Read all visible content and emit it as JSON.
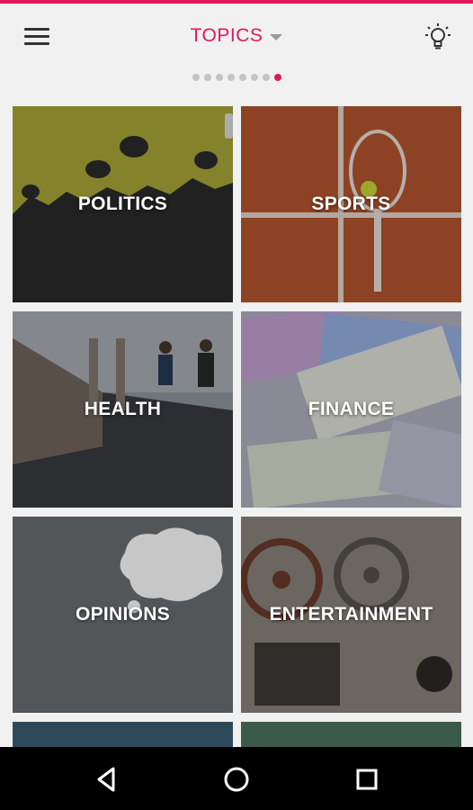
{
  "appbar": {
    "title": "TOPICS",
    "menu_icon": "hamburger-menu-icon",
    "theme_icon": "lightbulb-icon",
    "accent_color": "#e0185e"
  },
  "pager": {
    "count": 8,
    "active_index": 7
  },
  "topics": [
    {
      "label": "POLITICS"
    },
    {
      "label": "SPORTS"
    },
    {
      "label": "HEALTH"
    },
    {
      "label": "FINANCE"
    },
    {
      "label": "OPINIONS"
    },
    {
      "label": "ENTERTAINMENT"
    }
  ],
  "navbar": {
    "back_icon": "back-triangle-icon",
    "home_icon": "home-circle-icon",
    "recents_icon": "recents-square-icon"
  }
}
